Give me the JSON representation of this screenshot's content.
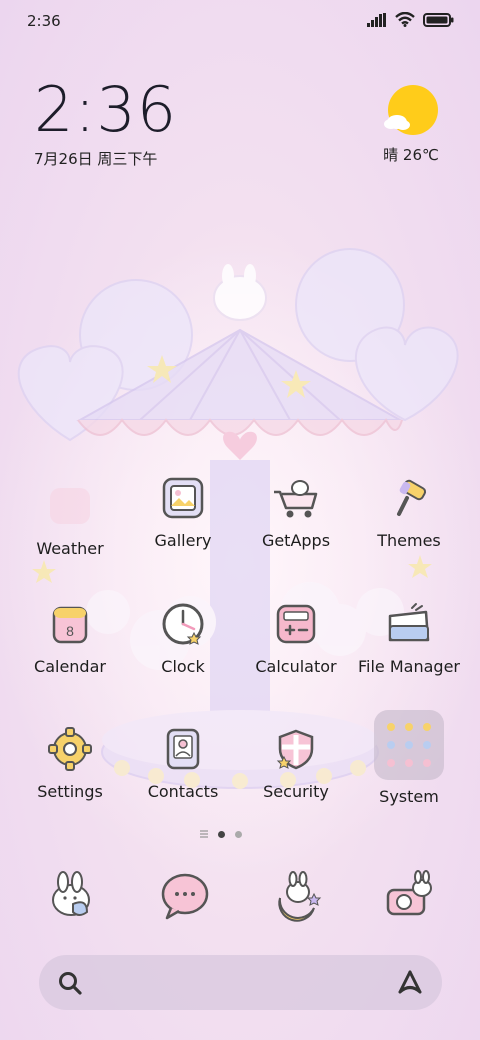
{
  "status_bar": {
    "time": "2:36"
  },
  "clock_widget": {
    "time": "2:36",
    "date": "7月26日 周三下午"
  },
  "weather_widget": {
    "icon": "sun-cloud-icon",
    "text": "晴 26℃"
  },
  "apps": [
    {
      "id": "weather",
      "label": "Weather",
      "icon": "weather-icon"
    },
    {
      "id": "gallery",
      "label": "Gallery",
      "icon": "gallery-icon"
    },
    {
      "id": "getapps",
      "label": "GetApps",
      "icon": "getapps-icon"
    },
    {
      "id": "themes",
      "label": "Themes",
      "icon": "themes-icon"
    },
    {
      "id": "calendar",
      "label": "Calendar",
      "icon": "calendar-icon",
      "badge": "8"
    },
    {
      "id": "clock",
      "label": "Clock",
      "icon": "clock-icon"
    },
    {
      "id": "calculator",
      "label": "Calculator",
      "icon": "calculator-icon"
    },
    {
      "id": "file-manager",
      "label": "File Manager",
      "icon": "folder-icon"
    },
    {
      "id": "settings",
      "label": "Settings",
      "icon": "gear-icon"
    },
    {
      "id": "contacts",
      "label": "Contacts",
      "icon": "contacts-icon"
    },
    {
      "id": "security",
      "label": "Security",
      "icon": "shield-icon"
    },
    {
      "id": "system",
      "label": "System",
      "icon": "folder-grid-icon"
    }
  ],
  "page_indicator": {
    "pages": 2,
    "current": 1
  },
  "dock": [
    {
      "id": "phone",
      "icon": "phone-bunny-icon"
    },
    {
      "id": "messages",
      "icon": "message-bubble-icon"
    },
    {
      "id": "browser",
      "icon": "moon-bunny-icon"
    },
    {
      "id": "camera",
      "icon": "camera-icon"
    }
  ],
  "search": {
    "icon": "search-icon",
    "assistant_icon": "assistant-icon"
  },
  "colors": {
    "accent_pink": "#f2a6c6",
    "accent_lilac": "#c9b8f0",
    "sun": "#ffcc1a",
    "text": "#1e1e1e"
  }
}
